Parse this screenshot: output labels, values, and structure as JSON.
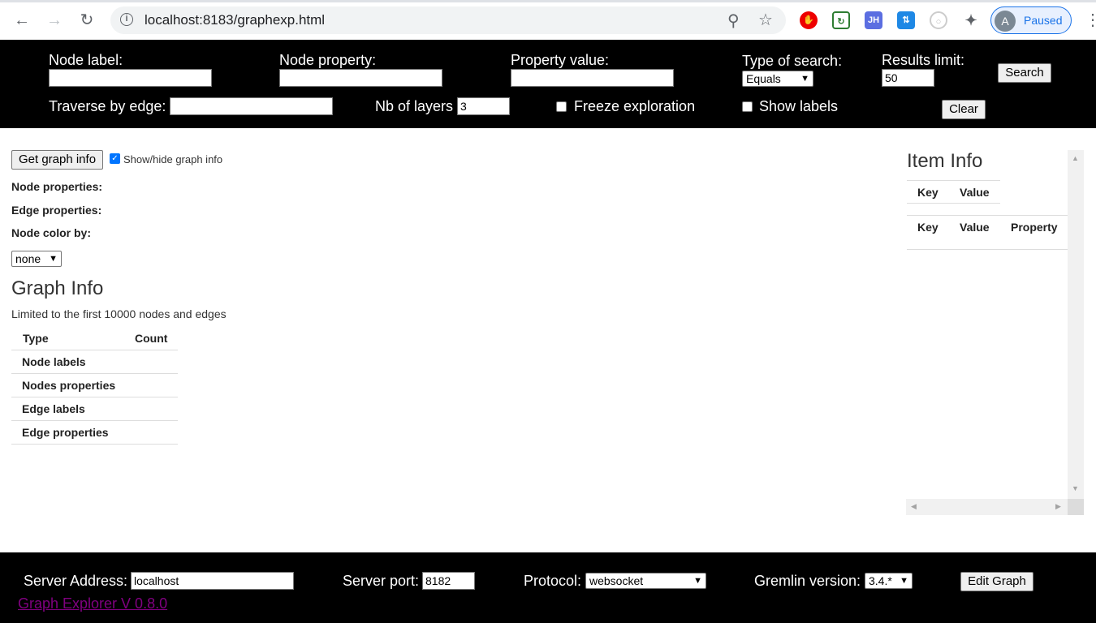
{
  "browser": {
    "url": "localhost:8183/graphexp.html",
    "profile_initial": "A",
    "profile_status": "Paused",
    "extensions": [
      "adblock-icon",
      "green-extension-icon",
      "jh-extension-icon",
      "blue-extension-icon",
      "circle-extension-icon",
      "puzzle-icon"
    ],
    "jh_label": "JH"
  },
  "search": {
    "node_label_label": "Node label:",
    "node_label_value": "",
    "node_property_label": "Node property:",
    "node_property_value": "",
    "property_value_label": "Property value:",
    "property_value_value": "",
    "type_label": "Type of search:",
    "type_value": "Equals",
    "limit_label": "Results limit:",
    "limit_value": "50",
    "search_button": "Search",
    "traverse_label": "Traverse by edge:",
    "traverse_value": "",
    "layers_label": "Nb of layers",
    "layers_value": "3",
    "freeze_label": "Freeze exploration",
    "freeze_checked": false,
    "show_labels_label": "Show labels",
    "show_labels_checked": false,
    "clear_button": "Clear"
  },
  "graph": {
    "get_info_button": "Get graph info",
    "show_hide_label": "Show/hide graph info",
    "show_hide_checked": true,
    "node_properties_label": "Node properties:",
    "edge_properties_label": "Edge properties:",
    "node_color_label": "Node color by:",
    "node_color_value": "none",
    "info_title": "Graph Info",
    "info_note": "Limited to the first 10000 nodes and edges",
    "table_headers": [
      "Type",
      "Count"
    ],
    "table_rows": [
      "Node labels",
      "Nodes properties",
      "Edge labels",
      "Edge properties"
    ]
  },
  "item_info": {
    "title": "Item Info",
    "table1_headers": [
      "Key",
      "Value"
    ],
    "table2_headers": [
      "Key",
      "Value",
      "Property"
    ]
  },
  "server": {
    "address_label": "Server Address:",
    "address_value": "localhost",
    "port_label": "Server port:",
    "port_value": "8182",
    "protocol_label": "Protocol:",
    "protocol_value": "websocket",
    "gremlin_label": "Gremlin version:",
    "gremlin_value": "3.4.*",
    "edit_button": "Edit Graph",
    "version_link": "Graph Explorer V 0.8.0"
  }
}
